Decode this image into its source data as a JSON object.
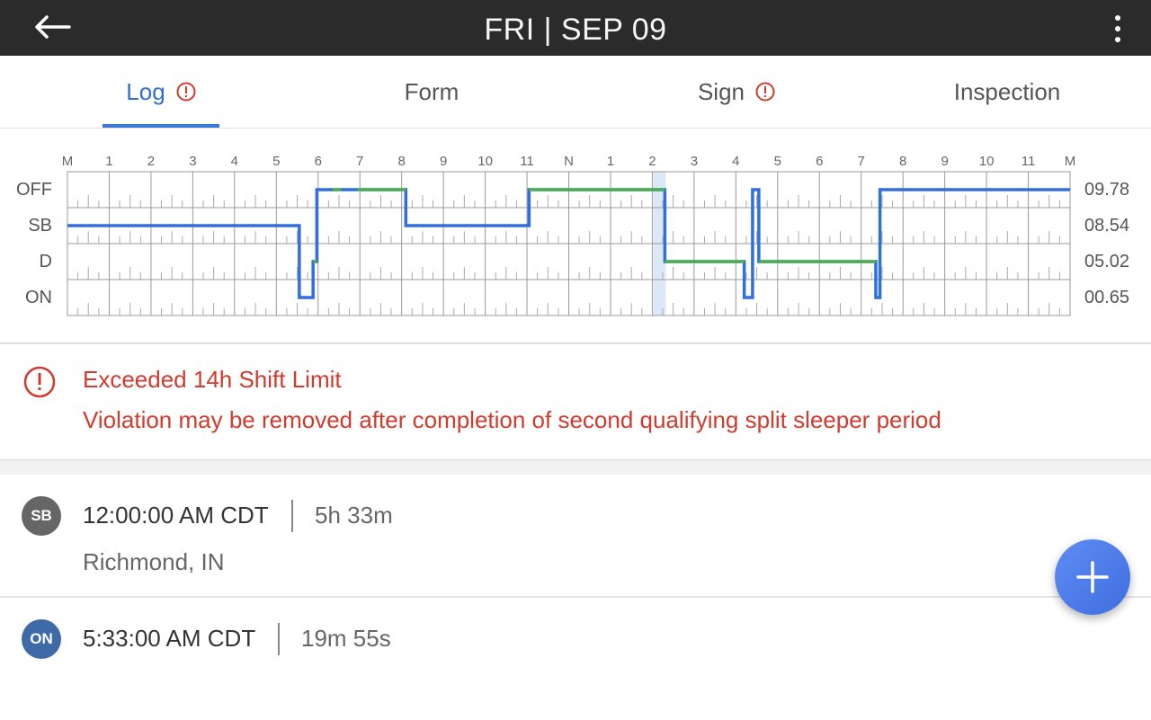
{
  "header": {
    "title": "FRI | SEP 09",
    "back_icon": "arrow-left-icon",
    "menu_icon": "more-vert-icon"
  },
  "tabs": [
    {
      "label": "Log",
      "active": true,
      "warning": true
    },
    {
      "label": "Form",
      "active": false,
      "warning": false
    },
    {
      "label": "Sign",
      "active": false,
      "warning": true
    },
    {
      "label": "Inspection",
      "active": false,
      "warning": false
    }
  ],
  "colors": {
    "accent": "#3a78d8",
    "status_line": "#2f6fe0",
    "driving_line": "#4caf50",
    "violation": "#d13a2c"
  },
  "chart_data": {
    "type": "line",
    "hour_labels": [
      "M",
      "1",
      "2",
      "3",
      "4",
      "5",
      "6",
      "7",
      "8",
      "9",
      "10",
      "11",
      "N",
      "1",
      "2",
      "3",
      "4",
      "5",
      "6",
      "7",
      "8",
      "9",
      "10",
      "11",
      "M"
    ],
    "rows": [
      "OFF",
      "SB",
      "D",
      "ON"
    ],
    "totals": [
      "09.78",
      "08.54",
      "05.02",
      "00.65"
    ],
    "highlight_hour": 14,
    "xlim": [
      0,
      24
    ],
    "segments": [
      {
        "status": "SB",
        "start": 0.0,
        "end": 5.55
      },
      {
        "status": "ON",
        "start": 5.55,
        "end": 5.88
      },
      {
        "status": "D",
        "start": 5.88,
        "end": 5.97
      },
      {
        "status": "OFF",
        "start": 5.97,
        "end": 8.1
      },
      {
        "status": "SB",
        "start": 8.1,
        "end": 11.05
      },
      {
        "status": "OFF",
        "start": 11.05,
        "end": 14.3
      },
      {
        "status": "D",
        "start": 14.3,
        "end": 16.2
      },
      {
        "status": "ON",
        "start": 16.2,
        "end": 16.4
      },
      {
        "status": "OFF",
        "start": 16.4,
        "end": 16.55
      },
      {
        "status": "D",
        "start": 16.55,
        "end": 19.35
      },
      {
        "status": "ON",
        "start": 19.35,
        "end": 19.45
      },
      {
        "status": "OFF",
        "start": 19.45,
        "end": 24.0
      }
    ],
    "green_overlays": [
      {
        "start": 6.35,
        "end": 6.55
      },
      {
        "start": 6.95,
        "end": 8.1
      },
      {
        "start": 11.05,
        "end": 14.3
      }
    ]
  },
  "violation": {
    "icon": "alert-circle-icon",
    "title": "Exceeded 14h Shift Limit",
    "message": "Violation may be removed after completion of second qualifying split sleeper period"
  },
  "events": [
    {
      "badge": "SB",
      "badge_color": "#666666",
      "time": "12:00:00 AM CDT",
      "duration": "5h 33m",
      "location": "Richmond, IN"
    },
    {
      "badge": "ON",
      "badge_color": "#3f6aa8",
      "time": "5:33:00 AM CDT",
      "duration": "19m 55s",
      "location": ""
    }
  ],
  "fab": {
    "icon": "plus-icon"
  }
}
